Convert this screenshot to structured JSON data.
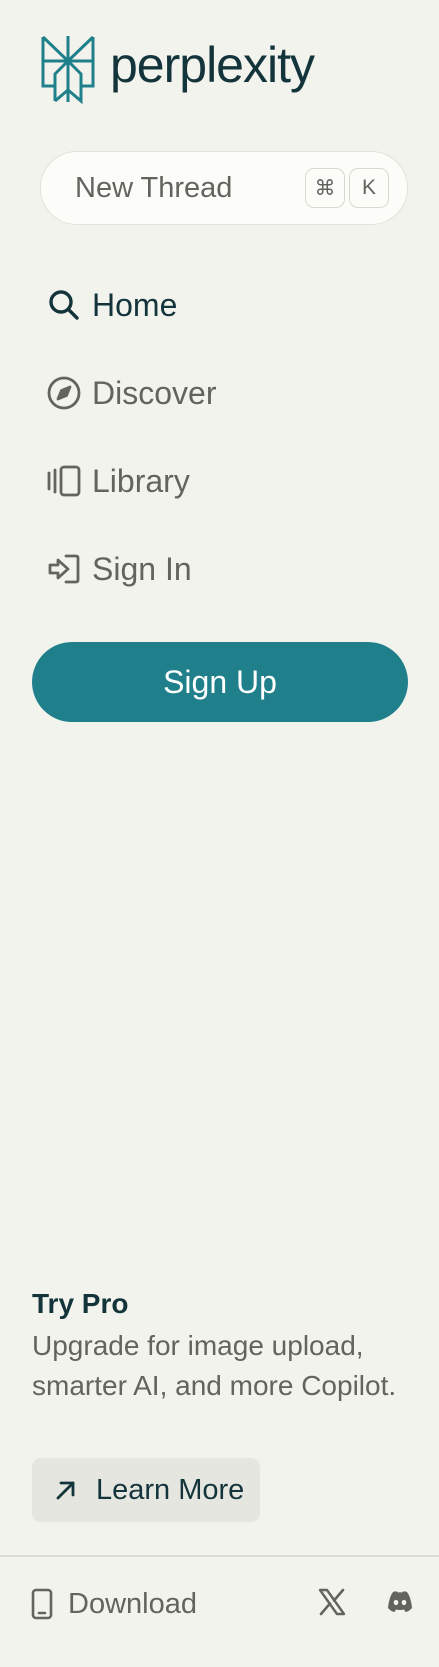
{
  "brand": {
    "name": "perplexity",
    "logo_icon": "perplexity-logo-icon",
    "logo_color": "#1f808b",
    "text_color": "#13343b"
  },
  "new_thread": {
    "label": "New Thread",
    "shortcut_keys": [
      "⌘",
      "K"
    ]
  },
  "nav": {
    "items": [
      {
        "label": "Home",
        "icon": "search-icon",
        "active": true
      },
      {
        "label": "Discover",
        "icon": "compass-icon",
        "active": false
      },
      {
        "label": "Library",
        "icon": "library-icon",
        "active": false
      },
      {
        "label": "Sign In",
        "icon": "sign-in-icon",
        "active": false
      }
    ]
  },
  "signup": {
    "label": "Sign Up",
    "color": "#1f808b"
  },
  "pro": {
    "title": "Try Pro",
    "description": "Upgrade for image upload, smarter AI, and more Copilot.",
    "cta_label": "Learn More",
    "cta_icon": "arrow-up-right-icon"
  },
  "footer": {
    "download_label": "Download",
    "download_icon": "phone-icon",
    "social": [
      {
        "icon": "x-icon"
      },
      {
        "icon": "discord-icon"
      }
    ]
  },
  "colors": {
    "background": "#f3f3ee",
    "muted_text": "#64645f",
    "accent": "#1f808b"
  }
}
